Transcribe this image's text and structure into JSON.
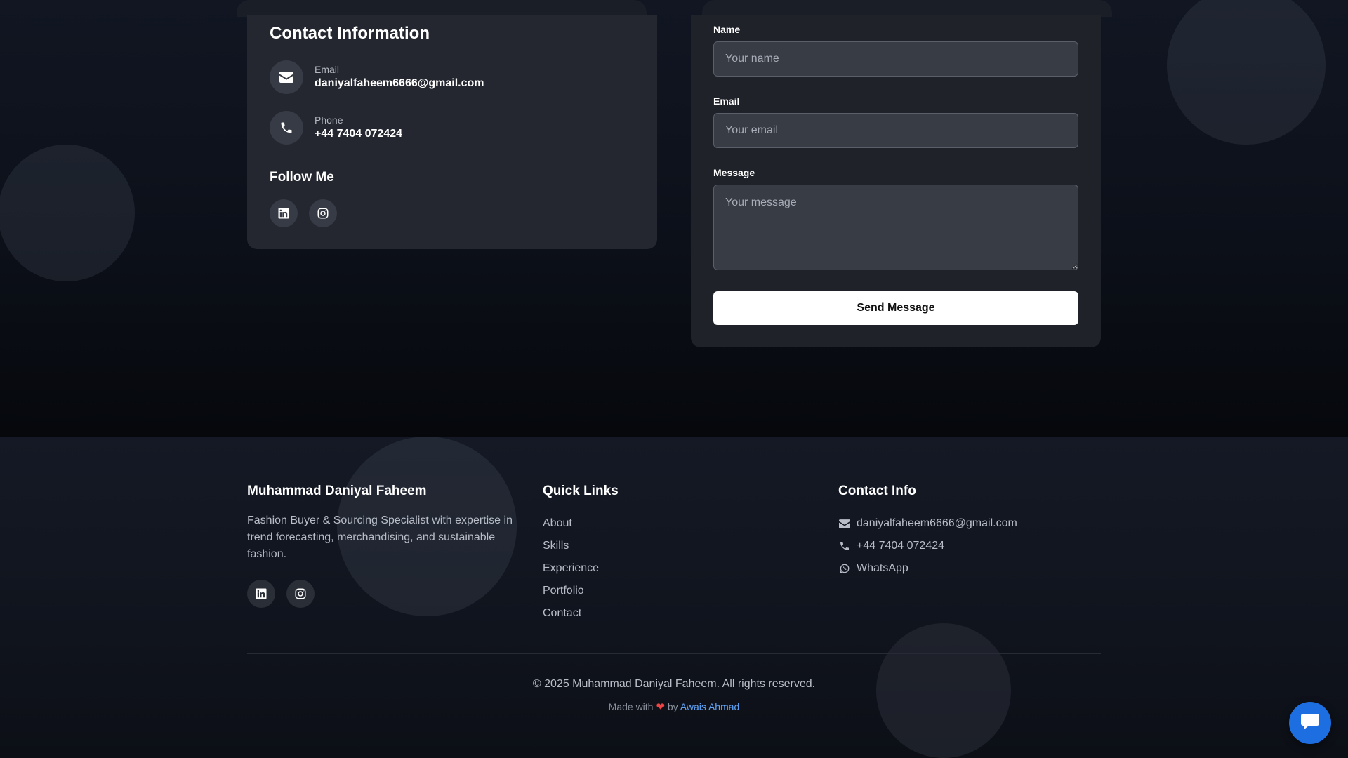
{
  "contact_info": {
    "title": "Contact Information",
    "email_label": "Email",
    "email_value": "daniyalfaheem6666@gmail.com",
    "phone_label": "Phone",
    "phone_value": "+44 7404 072424",
    "follow_title": "Follow Me",
    "social": [
      "linkedin-icon",
      "instagram-icon"
    ]
  },
  "form": {
    "name_label": "Name",
    "name_placeholder": "Your name",
    "email_label": "Email",
    "email_placeholder": "Your email",
    "message_label": "Message",
    "message_placeholder": "Your message",
    "submit_label": "Send Message"
  },
  "footer": {
    "brand_name": "Muhammad Daniyal Faheem",
    "brand_description": "Fashion Buyer & Sourcing Specialist with expertise in trend forecasting, merchandising, and sustainable fashion.",
    "quick_links_title": "Quick Links",
    "quick_links": [
      "About",
      "Skills",
      "Experience",
      "Portfolio",
      "Contact"
    ],
    "contact_title": "Contact Info",
    "contact_email": "daniyalfaheem6666@gmail.com",
    "contact_phone": "+44 7404 072424",
    "contact_whatsapp": "WhatsApp",
    "copyright": "© 2025 Muhammad Daniyal Faheem. All rights reserved.",
    "made_with_prefix": "Made with",
    "made_with_by": "by",
    "made_with_author": "Awais Ahmad"
  },
  "colors": {
    "accent_link": "#60a5fa",
    "heart": "#ef4444",
    "chat_button": "#1d6ee0"
  },
  "icons": {
    "chat_button": "chat-bubble-icon"
  }
}
